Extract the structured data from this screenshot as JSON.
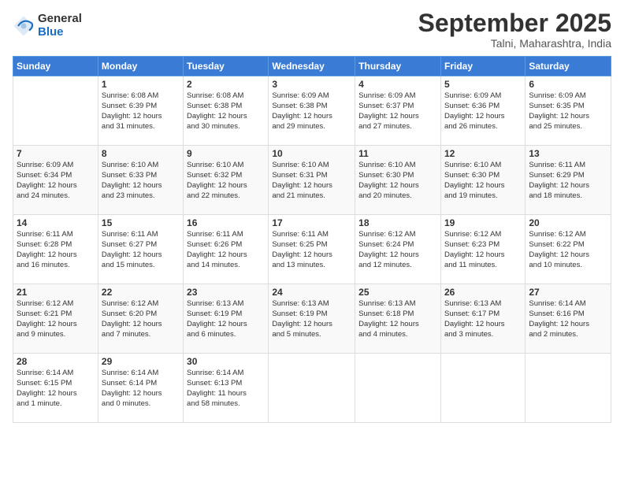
{
  "logo": {
    "general": "General",
    "blue": "Blue"
  },
  "header": {
    "month": "September 2025",
    "location": "Talni, Maharashtra, India"
  },
  "weekdays": [
    "Sunday",
    "Monday",
    "Tuesday",
    "Wednesday",
    "Thursday",
    "Friday",
    "Saturday"
  ],
  "weeks": [
    [
      {
        "day": "",
        "info": ""
      },
      {
        "day": "1",
        "info": "Sunrise: 6:08 AM\nSunset: 6:39 PM\nDaylight: 12 hours\nand 31 minutes."
      },
      {
        "day": "2",
        "info": "Sunrise: 6:08 AM\nSunset: 6:38 PM\nDaylight: 12 hours\nand 30 minutes."
      },
      {
        "day": "3",
        "info": "Sunrise: 6:09 AM\nSunset: 6:38 PM\nDaylight: 12 hours\nand 29 minutes."
      },
      {
        "day": "4",
        "info": "Sunrise: 6:09 AM\nSunset: 6:37 PM\nDaylight: 12 hours\nand 27 minutes."
      },
      {
        "day": "5",
        "info": "Sunrise: 6:09 AM\nSunset: 6:36 PM\nDaylight: 12 hours\nand 26 minutes."
      },
      {
        "day": "6",
        "info": "Sunrise: 6:09 AM\nSunset: 6:35 PM\nDaylight: 12 hours\nand 25 minutes."
      }
    ],
    [
      {
        "day": "7",
        "info": "Sunrise: 6:09 AM\nSunset: 6:34 PM\nDaylight: 12 hours\nand 24 minutes."
      },
      {
        "day": "8",
        "info": "Sunrise: 6:10 AM\nSunset: 6:33 PM\nDaylight: 12 hours\nand 23 minutes."
      },
      {
        "day": "9",
        "info": "Sunrise: 6:10 AM\nSunset: 6:32 PM\nDaylight: 12 hours\nand 22 minutes."
      },
      {
        "day": "10",
        "info": "Sunrise: 6:10 AM\nSunset: 6:31 PM\nDaylight: 12 hours\nand 21 minutes."
      },
      {
        "day": "11",
        "info": "Sunrise: 6:10 AM\nSunset: 6:30 PM\nDaylight: 12 hours\nand 20 minutes."
      },
      {
        "day": "12",
        "info": "Sunrise: 6:10 AM\nSunset: 6:30 PM\nDaylight: 12 hours\nand 19 minutes."
      },
      {
        "day": "13",
        "info": "Sunrise: 6:11 AM\nSunset: 6:29 PM\nDaylight: 12 hours\nand 18 minutes."
      }
    ],
    [
      {
        "day": "14",
        "info": "Sunrise: 6:11 AM\nSunset: 6:28 PM\nDaylight: 12 hours\nand 16 minutes."
      },
      {
        "day": "15",
        "info": "Sunrise: 6:11 AM\nSunset: 6:27 PM\nDaylight: 12 hours\nand 15 minutes."
      },
      {
        "day": "16",
        "info": "Sunrise: 6:11 AM\nSunset: 6:26 PM\nDaylight: 12 hours\nand 14 minutes."
      },
      {
        "day": "17",
        "info": "Sunrise: 6:11 AM\nSunset: 6:25 PM\nDaylight: 12 hours\nand 13 minutes."
      },
      {
        "day": "18",
        "info": "Sunrise: 6:12 AM\nSunset: 6:24 PM\nDaylight: 12 hours\nand 12 minutes."
      },
      {
        "day": "19",
        "info": "Sunrise: 6:12 AM\nSunset: 6:23 PM\nDaylight: 12 hours\nand 11 minutes."
      },
      {
        "day": "20",
        "info": "Sunrise: 6:12 AM\nSunset: 6:22 PM\nDaylight: 12 hours\nand 10 minutes."
      }
    ],
    [
      {
        "day": "21",
        "info": "Sunrise: 6:12 AM\nSunset: 6:21 PM\nDaylight: 12 hours\nand 9 minutes."
      },
      {
        "day": "22",
        "info": "Sunrise: 6:12 AM\nSunset: 6:20 PM\nDaylight: 12 hours\nand 7 minutes."
      },
      {
        "day": "23",
        "info": "Sunrise: 6:13 AM\nSunset: 6:19 PM\nDaylight: 12 hours\nand 6 minutes."
      },
      {
        "day": "24",
        "info": "Sunrise: 6:13 AM\nSunset: 6:19 PM\nDaylight: 12 hours\nand 5 minutes."
      },
      {
        "day": "25",
        "info": "Sunrise: 6:13 AM\nSunset: 6:18 PM\nDaylight: 12 hours\nand 4 minutes."
      },
      {
        "day": "26",
        "info": "Sunrise: 6:13 AM\nSunset: 6:17 PM\nDaylight: 12 hours\nand 3 minutes."
      },
      {
        "day": "27",
        "info": "Sunrise: 6:14 AM\nSunset: 6:16 PM\nDaylight: 12 hours\nand 2 minutes."
      }
    ],
    [
      {
        "day": "28",
        "info": "Sunrise: 6:14 AM\nSunset: 6:15 PM\nDaylight: 12 hours\nand 1 minute."
      },
      {
        "day": "29",
        "info": "Sunrise: 6:14 AM\nSunset: 6:14 PM\nDaylight: 12 hours\nand 0 minutes."
      },
      {
        "day": "30",
        "info": "Sunrise: 6:14 AM\nSunset: 6:13 PM\nDaylight: 11 hours\nand 58 minutes."
      },
      {
        "day": "",
        "info": ""
      },
      {
        "day": "",
        "info": ""
      },
      {
        "day": "",
        "info": ""
      },
      {
        "day": "",
        "info": ""
      }
    ]
  ]
}
